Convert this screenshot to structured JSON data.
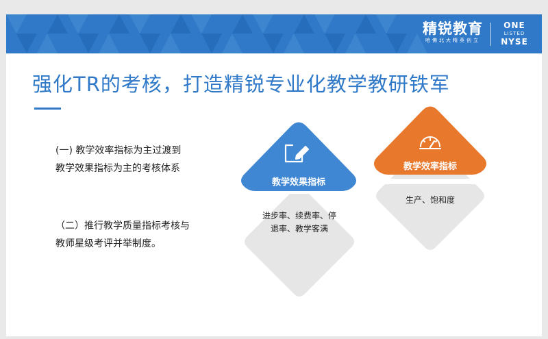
{
  "slide": {
    "title": "强化TR的考核，打造精锐专业化教学教研铁军"
  },
  "brand": {
    "name": "精锐教育",
    "tagline": "哈佛北大精英创立",
    "listing": [
      "ONE",
      "LISTED",
      "NYSE"
    ]
  },
  "left_points": {
    "point1_line1": "(一) 教学效率指标为主过渡到",
    "point1_line2": "教学效果指标为主的考核体系",
    "point2_line1": "（二）推行教学质量指标考核与",
    "point2_line2": "教师星级考评并举制度。"
  },
  "diamonds": {
    "effect": {
      "label": "教学效果指标",
      "desc_line1": "进步率、续费率、停",
      "desc_line2": "退率、教学客满",
      "icon": "edit-icon",
      "color": "#3f87d3"
    },
    "efficiency": {
      "label": "教学效率指标",
      "desc": "生产、饱和度",
      "icon": "speedometer-icon",
      "color": "#e8782c"
    }
  },
  "colors": {
    "primary_blue": "#2f79c8",
    "orange": "#e8782c",
    "gray_diamond": "#e6e6e6"
  }
}
